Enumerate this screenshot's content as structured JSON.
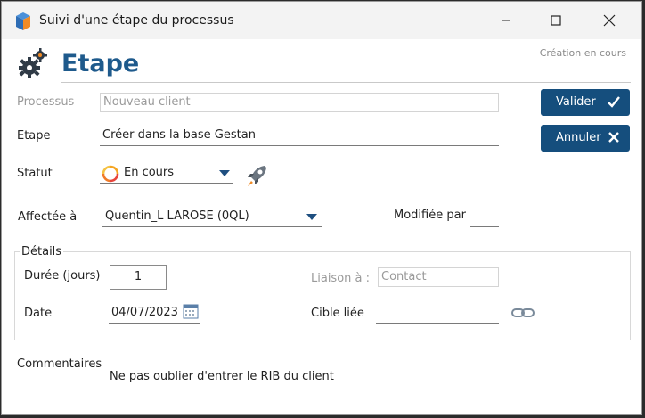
{
  "window": {
    "title": "Suivi d'une étape du processus"
  },
  "header": {
    "title": "Etape",
    "status": "Création en cours"
  },
  "form": {
    "processus": {
      "label": "Processus",
      "value": "Nouveau client"
    },
    "etape": {
      "label": "Etape",
      "value": "Créer dans la base Gestan"
    },
    "statut": {
      "label": "Statut",
      "value": "En cours"
    },
    "affectee": {
      "label": "Affectée à",
      "value": "Quentin_L LAROSE (0QL)"
    },
    "modifiee": {
      "label": "Modifiée par",
      "value": ""
    }
  },
  "details": {
    "title": "Détails",
    "duree": {
      "label": "Durée (jours)",
      "value": "1"
    },
    "date": {
      "label": "Date",
      "value": "04/07/2023"
    },
    "liaison": {
      "label": "Liaison à :",
      "value": "Contact"
    },
    "cible": {
      "label": "Cible liée",
      "value": ""
    }
  },
  "commentaires": {
    "label": "Commentaires",
    "value": "Ne pas oublier d'entrer le RIB du client"
  },
  "buttons": {
    "valider": "Valider",
    "annuler": "Annuler"
  },
  "colors": {
    "accent": "#1e5a8c",
    "button": "#154e7d"
  }
}
